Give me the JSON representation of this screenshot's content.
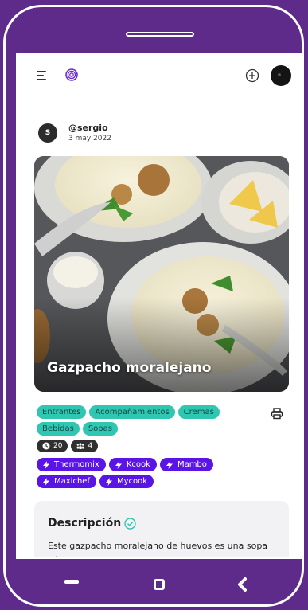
{
  "app": {
    "header": {
      "menu_icon": "menu-icon",
      "logo_icon": "spiral-logo-icon",
      "add_icon": "plus-circle-icon",
      "avatar_icon": "user-avatar"
    },
    "author": {
      "initial": "S",
      "name": "@sergio",
      "date": "3 may 2022"
    },
    "recipe": {
      "title": "Gazpacho moralejano",
      "tags": [
        "Entrantes",
        "Acompañamientos",
        "Cremas",
        "Bebidas",
        "Sopas"
      ],
      "time": "20",
      "servings": "4",
      "devices": [
        "Thermomix",
        "Kcook",
        "Mambo",
        "Maxichef",
        "Mycook"
      ]
    },
    "description": {
      "title": "Descripción",
      "text": "Este gazpacho moralejano de huevos es una sopa fría de huevos cocidos, leche y aceite de oliva tradicional"
    },
    "colors": {
      "tag": "#2fc6b2",
      "device": "#5b14e6",
      "frame": "#5e2b8a"
    }
  }
}
